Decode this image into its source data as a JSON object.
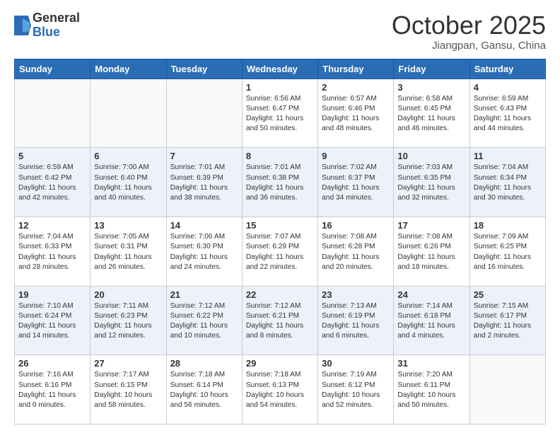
{
  "header": {
    "logo_general": "General",
    "logo_blue": "Blue",
    "month": "October 2025",
    "location": "Jiangpan, Gansu, China"
  },
  "weekdays": [
    "Sunday",
    "Monday",
    "Tuesday",
    "Wednesday",
    "Thursday",
    "Friday",
    "Saturday"
  ],
  "weeks": [
    [
      {
        "day": "",
        "info": ""
      },
      {
        "day": "",
        "info": ""
      },
      {
        "day": "",
        "info": ""
      },
      {
        "day": "1",
        "info": "Sunrise: 6:56 AM\nSunset: 6:47 PM\nDaylight: 11 hours\nand 50 minutes."
      },
      {
        "day": "2",
        "info": "Sunrise: 6:57 AM\nSunset: 6:46 PM\nDaylight: 11 hours\nand 48 minutes."
      },
      {
        "day": "3",
        "info": "Sunrise: 6:58 AM\nSunset: 6:45 PM\nDaylight: 11 hours\nand 46 minutes."
      },
      {
        "day": "4",
        "info": "Sunrise: 6:59 AM\nSunset: 6:43 PM\nDaylight: 11 hours\nand 44 minutes."
      }
    ],
    [
      {
        "day": "5",
        "info": "Sunrise: 6:59 AM\nSunset: 6:42 PM\nDaylight: 11 hours\nand 42 minutes."
      },
      {
        "day": "6",
        "info": "Sunrise: 7:00 AM\nSunset: 6:40 PM\nDaylight: 11 hours\nand 40 minutes."
      },
      {
        "day": "7",
        "info": "Sunrise: 7:01 AM\nSunset: 6:39 PM\nDaylight: 11 hours\nand 38 minutes."
      },
      {
        "day": "8",
        "info": "Sunrise: 7:01 AM\nSunset: 6:38 PM\nDaylight: 11 hours\nand 36 minutes."
      },
      {
        "day": "9",
        "info": "Sunrise: 7:02 AM\nSunset: 6:37 PM\nDaylight: 11 hours\nand 34 minutes."
      },
      {
        "day": "10",
        "info": "Sunrise: 7:03 AM\nSunset: 6:35 PM\nDaylight: 11 hours\nand 32 minutes."
      },
      {
        "day": "11",
        "info": "Sunrise: 7:04 AM\nSunset: 6:34 PM\nDaylight: 11 hours\nand 30 minutes."
      }
    ],
    [
      {
        "day": "12",
        "info": "Sunrise: 7:04 AM\nSunset: 6:33 PM\nDaylight: 11 hours\nand 28 minutes."
      },
      {
        "day": "13",
        "info": "Sunrise: 7:05 AM\nSunset: 6:31 PM\nDaylight: 11 hours\nand 26 minutes."
      },
      {
        "day": "14",
        "info": "Sunrise: 7:06 AM\nSunset: 6:30 PM\nDaylight: 11 hours\nand 24 minutes."
      },
      {
        "day": "15",
        "info": "Sunrise: 7:07 AM\nSunset: 6:29 PM\nDaylight: 11 hours\nand 22 minutes."
      },
      {
        "day": "16",
        "info": "Sunrise: 7:08 AM\nSunset: 6:28 PM\nDaylight: 11 hours\nand 20 minutes."
      },
      {
        "day": "17",
        "info": "Sunrise: 7:08 AM\nSunset: 6:26 PM\nDaylight: 11 hours\nand 18 minutes."
      },
      {
        "day": "18",
        "info": "Sunrise: 7:09 AM\nSunset: 6:25 PM\nDaylight: 11 hours\nand 16 minutes."
      }
    ],
    [
      {
        "day": "19",
        "info": "Sunrise: 7:10 AM\nSunset: 6:24 PM\nDaylight: 11 hours\nand 14 minutes."
      },
      {
        "day": "20",
        "info": "Sunrise: 7:11 AM\nSunset: 6:23 PM\nDaylight: 11 hours\nand 12 minutes."
      },
      {
        "day": "21",
        "info": "Sunrise: 7:12 AM\nSunset: 6:22 PM\nDaylight: 11 hours\nand 10 minutes."
      },
      {
        "day": "22",
        "info": "Sunrise: 7:12 AM\nSunset: 6:21 PM\nDaylight: 11 hours\nand 8 minutes."
      },
      {
        "day": "23",
        "info": "Sunrise: 7:13 AM\nSunset: 6:19 PM\nDaylight: 11 hours\nand 6 minutes."
      },
      {
        "day": "24",
        "info": "Sunrise: 7:14 AM\nSunset: 6:18 PM\nDaylight: 11 hours\nand 4 minutes."
      },
      {
        "day": "25",
        "info": "Sunrise: 7:15 AM\nSunset: 6:17 PM\nDaylight: 11 hours\nand 2 minutes."
      }
    ],
    [
      {
        "day": "26",
        "info": "Sunrise: 7:16 AM\nSunset: 6:16 PM\nDaylight: 11 hours\nand 0 minutes."
      },
      {
        "day": "27",
        "info": "Sunrise: 7:17 AM\nSunset: 6:15 PM\nDaylight: 10 hours\nand 58 minutes."
      },
      {
        "day": "28",
        "info": "Sunrise: 7:18 AM\nSunset: 6:14 PM\nDaylight: 10 hours\nand 56 minutes."
      },
      {
        "day": "29",
        "info": "Sunrise: 7:18 AM\nSunset: 6:13 PM\nDaylight: 10 hours\nand 54 minutes."
      },
      {
        "day": "30",
        "info": "Sunrise: 7:19 AM\nSunset: 6:12 PM\nDaylight: 10 hours\nand 52 minutes."
      },
      {
        "day": "31",
        "info": "Sunrise: 7:20 AM\nSunset: 6:11 PM\nDaylight: 10 hours\nand 50 minutes."
      },
      {
        "day": "",
        "info": ""
      }
    ]
  ]
}
